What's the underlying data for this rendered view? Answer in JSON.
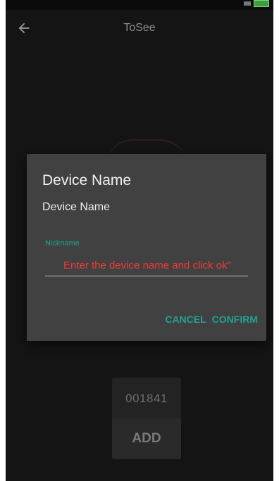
{
  "app_bar": {
    "title": "ToSee",
    "back_icon": "arrow-left-icon"
  },
  "device_card": {
    "device_id": "001841",
    "add_label": "ADD"
  },
  "dialog": {
    "title": "Device Name",
    "message": "Device Name",
    "field_label": "Nickname",
    "field_placeholder": "Enter the device name and click ok\"",
    "field_value": "",
    "cancel_label": "CANCEL",
    "confirm_label": "CONFIRM"
  },
  "colors": {
    "accent": "#1fa392",
    "error_hint": "#f03a3a",
    "dialog_bg": "#414141",
    "screen_bg": "#141414"
  }
}
